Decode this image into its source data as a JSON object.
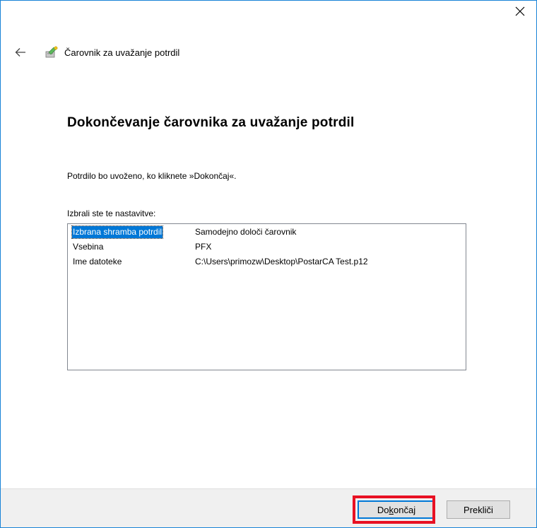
{
  "window": {
    "title": "Čarovnik za uvažanje potrdil",
    "close_icon": "close-icon",
    "back_icon": "back-arrow-icon",
    "wizard_icon": "certificate-wizard-icon",
    "border_color": "#1883d7"
  },
  "main": {
    "heading": "Dokončevanje čarovnika za uvažanje potrdil",
    "info": "Potrdilo bo uvoženo, ko kliknete »Dokončaj«.",
    "settings_label": "Izbrali ste te nastavitve:",
    "settings": [
      {
        "name": "Izbrana shramba potrdil",
        "value": "Samodejno določi čarovnik",
        "selected": true
      },
      {
        "name": "Vsebina",
        "value": "PFX",
        "selected": false
      },
      {
        "name": "Ime datoteke",
        "value": "C:\\Users\\primozw\\Desktop\\PostarCA Test.p12",
        "selected": false
      }
    ]
  },
  "footer": {
    "finish_pre": "Do",
    "finish_accel": "k",
    "finish_post": "ončaj",
    "cancel_label": "Prekliči"
  },
  "colors": {
    "selection": "#0078d7",
    "highlight": "#e81123",
    "default_button_border": "#0078d7"
  }
}
